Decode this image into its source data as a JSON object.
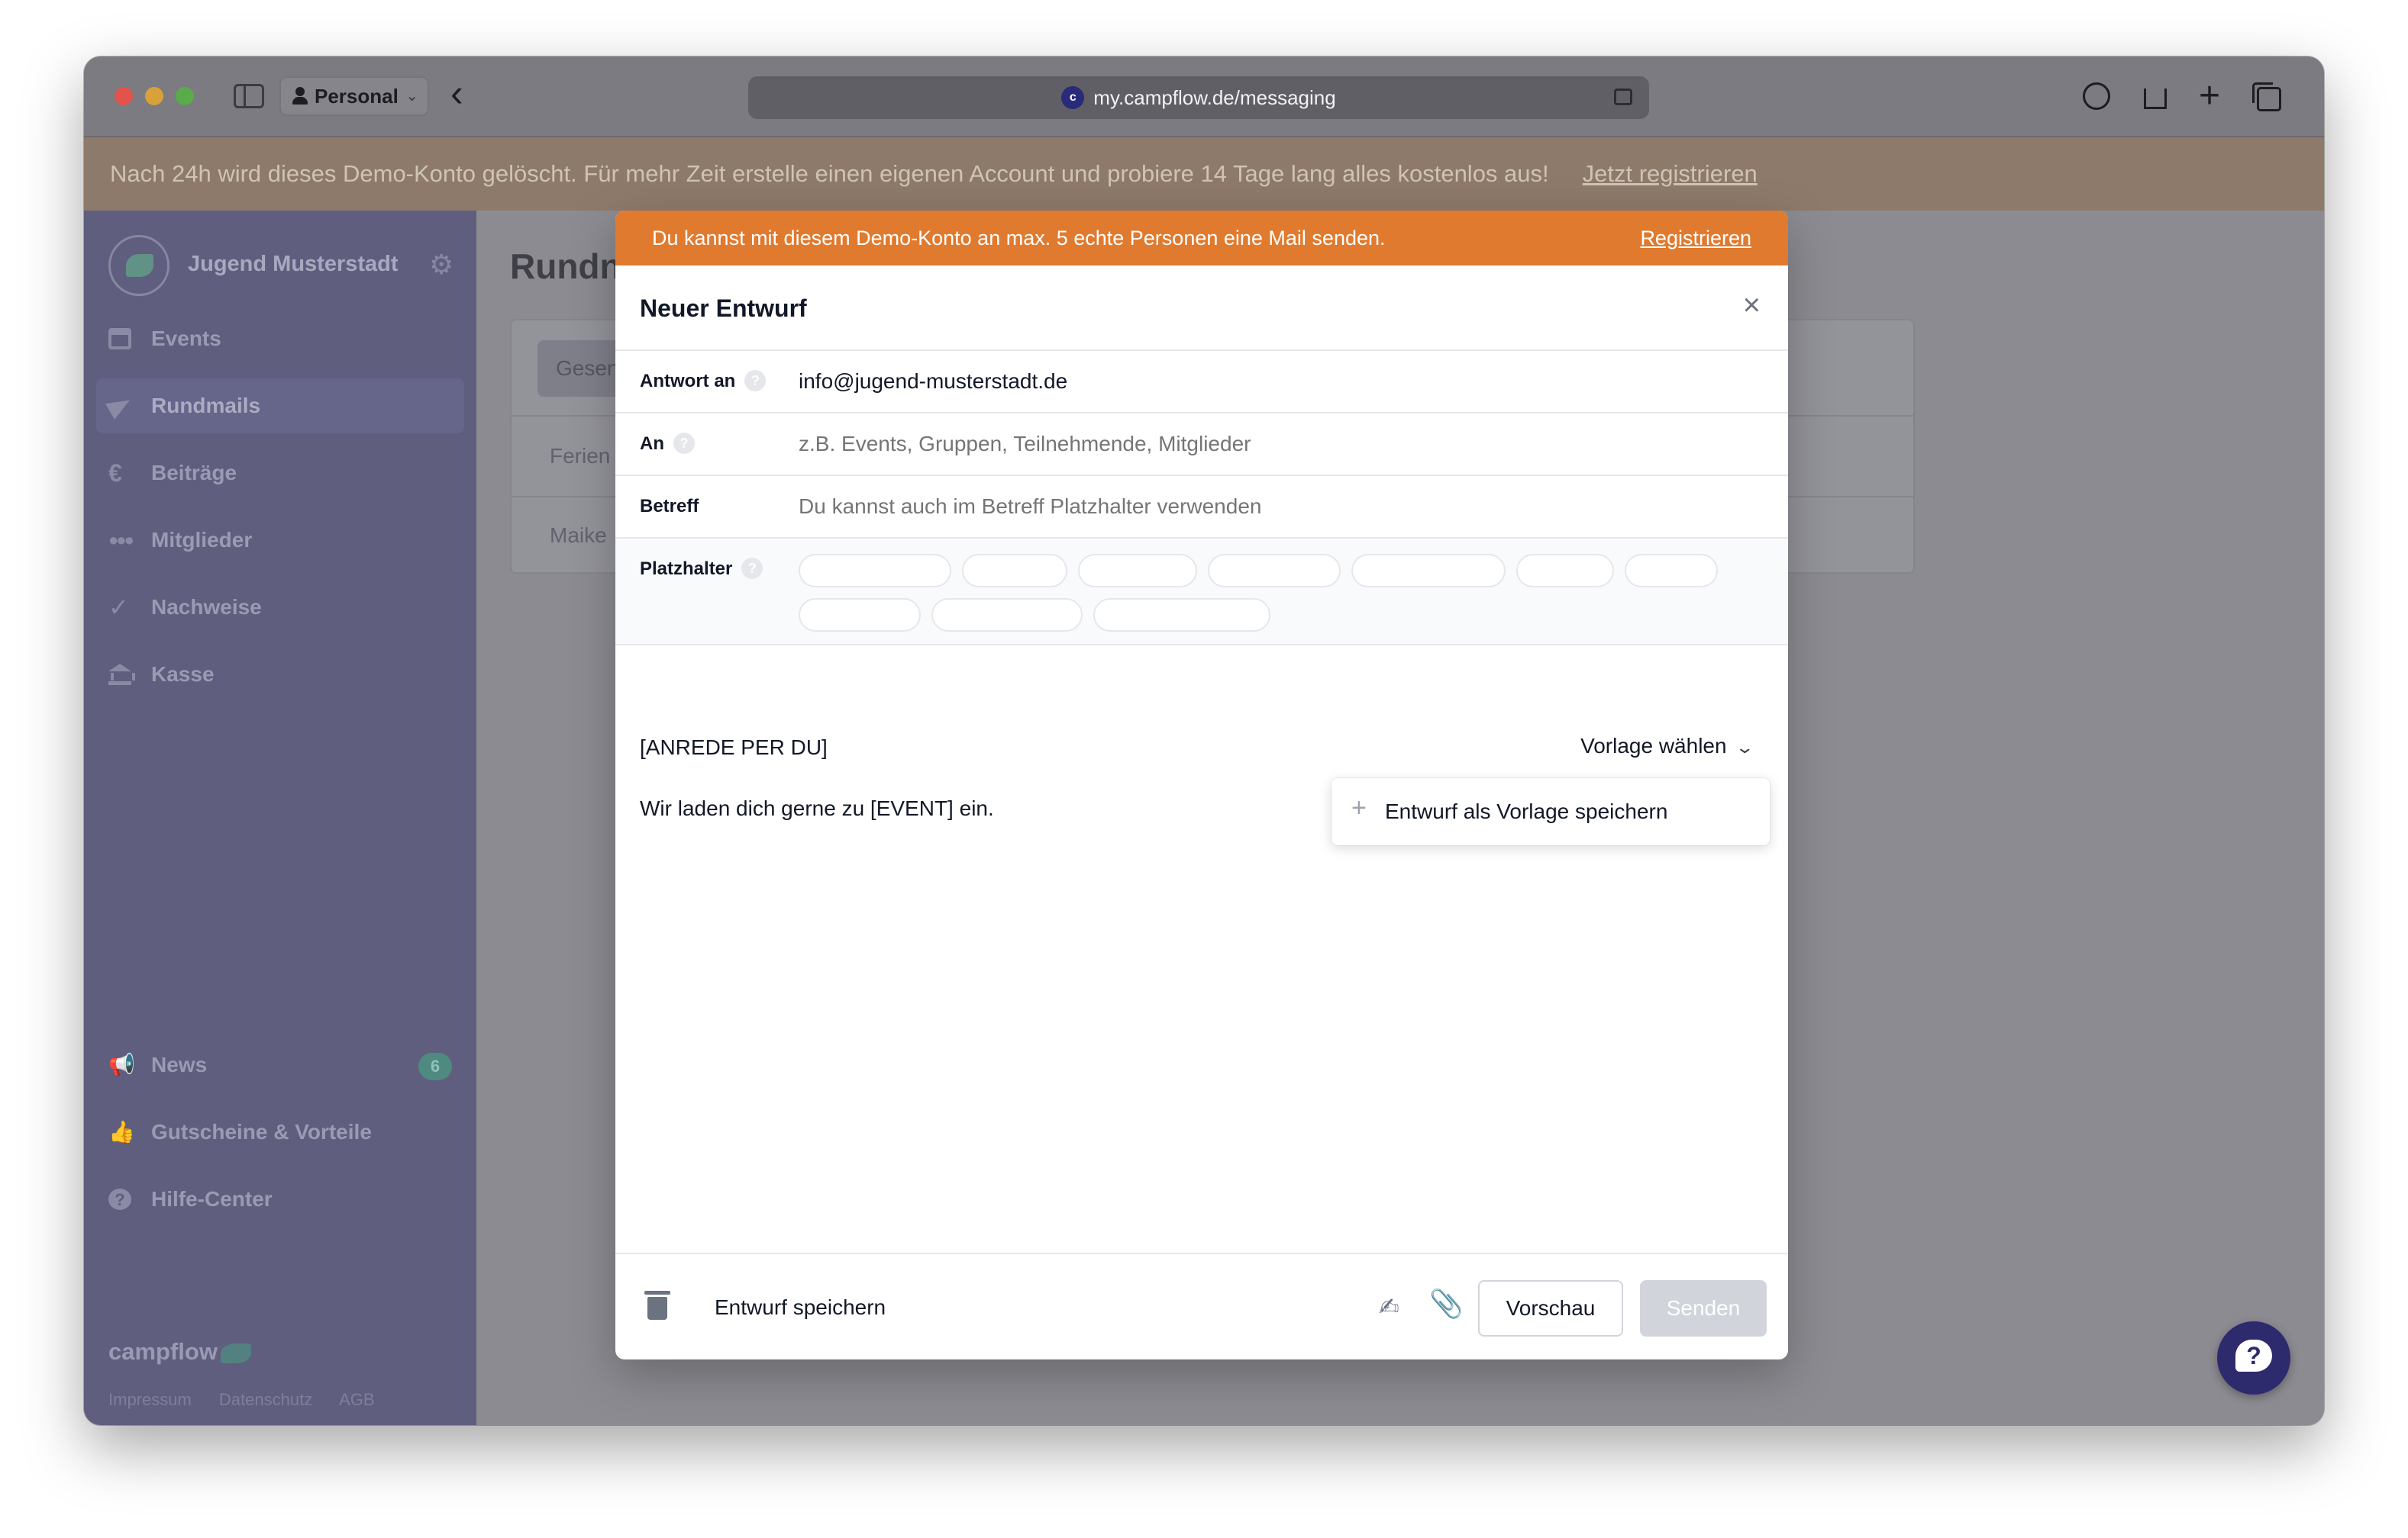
{
  "browser": {
    "profile_label": "Personal",
    "url": "my.campflow.de/messaging"
  },
  "demo_banner": {
    "text": "Nach 24h wird dieses Demo-Konto gelöscht.  Für mehr Zeit erstelle einen eigenen Account und probiere 14 Tage lang alles kostenlos aus!",
    "link": "Jetzt registrieren"
  },
  "sidebar": {
    "org_name": "Jugend Musterstadt",
    "items": [
      {
        "label": "Events",
        "icon": "calendar-icon"
      },
      {
        "label": "Rundmails",
        "icon": "paper-plane-icon",
        "active": true
      },
      {
        "label": "Beiträge",
        "icon": "euro-icon"
      },
      {
        "label": "Mitglieder",
        "icon": "users-icon"
      },
      {
        "label": "Nachweise",
        "icon": "check-icon"
      },
      {
        "label": "Kasse",
        "icon": "bank-icon"
      }
    ],
    "bottom_items": [
      {
        "label": "News",
        "icon": "megaphone-icon",
        "badge": "6"
      },
      {
        "label": "Gutscheine & Vorteile",
        "icon": "thumbs-up-icon"
      },
      {
        "label": "Hilfe-Center",
        "icon": "help-circle-icon"
      }
    ],
    "brand": "campflow",
    "footer_links": [
      "Impressum",
      "Datenschutz",
      "AGB"
    ]
  },
  "background": {
    "title": "Rundn",
    "tab": "Gesen",
    "row1": "Ferien",
    "row2": "Maike"
  },
  "modal": {
    "warning": "Du kannst mit diesem Demo-Konto an max. 5 echte Personen eine Mail senden.",
    "warning_link": "Registrieren",
    "title": "Neuer Entwurf",
    "fields": {
      "reply_to_label": "Antwort an",
      "reply_to_value": "info@jugend-musterstadt.de",
      "to_label": "An",
      "to_placeholder": "z.B. Events, Gruppen, Teilnehmende, Mitglieder",
      "subject_label": "Betreff",
      "subject_placeholder": "Du kannst auch im Betreff Platzhalter verwenden",
      "placeholders_label": "Platzhalter"
    },
    "body": {
      "salutation": "[ANREDE PER DU]",
      "text": "Wir laden dich gerne zu [EVENT] ein.",
      "template_select": "Vorlage wählen",
      "dropdown_item": "Entwurf als Vorlage speichern"
    },
    "footer": {
      "save_draft": "Entwurf speichern",
      "preview": "Vorschau",
      "send": "Senden"
    }
  },
  "colors": {
    "warning_orange": "#e07a2e",
    "sidebar_bg": "#5f5e7e",
    "help_bubble": "#2e2a6e"
  }
}
